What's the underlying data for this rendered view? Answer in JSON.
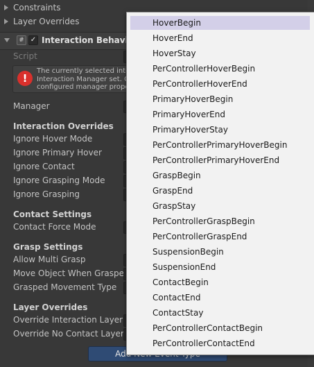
{
  "inspector": {
    "constraints_label": "Constraints",
    "layer_overrides_top_label": "Layer Overrides",
    "component_title": "Interaction Behaviour",
    "script_label": "Script",
    "help_text": "The currently selected inter\nInteraction Manager set. O\nconfigured manager proper",
    "manager_label": "Manager",
    "interaction_overrides_header": "Interaction Overrides",
    "ignore_hover_mode": "Ignore Hover Mode",
    "ignore_primary_hover": "Ignore Primary Hover",
    "ignore_contact": "Ignore Contact",
    "ignore_grasping_mode": "Ignore Grasping Mode",
    "ignore_grasping": "Ignore Grasping",
    "contact_settings_header": "Contact Settings",
    "contact_force_mode": "Contact Force Mode",
    "grasp_settings_header": "Grasp Settings",
    "allow_multi_grasp": "Allow Multi Grasp",
    "move_object_when_grasped": "Move Object When Grasped",
    "grasped_movement_type": "Grasped Movement Type",
    "layer_overrides_header": "Layer Overrides",
    "override_interaction_layer": "Override Interaction Layer",
    "override_no_contact_layer": "Override No Contact Layer",
    "add_event_button": "Add New Event Type"
  },
  "dropdown": {
    "selected": "HoverBegin",
    "items": [
      "HoverBegin",
      "HoverEnd",
      "HoverStay",
      "PerControllerHoverBegin",
      "PerControllerHoverEnd",
      "PrimaryHoverBegin",
      "PrimaryHoverEnd",
      "PrimaryHoverStay",
      "PerControllerPrimaryHoverBegin",
      "PerControllerPrimaryHoverEnd",
      "GraspBegin",
      "GraspEnd",
      "GraspStay",
      "PerControllerGraspBegin",
      "PerControllerGraspEnd",
      "SuspensionBegin",
      "SuspensionEnd",
      "ContactBegin",
      "ContactEnd",
      "ContactStay",
      "PerControllerContactBegin",
      "PerControllerContactEnd"
    ]
  },
  "colors": {
    "background": "#383838",
    "dropdown_bg": "#f2f2f2",
    "selected_item": "#d3cfe8",
    "error_icon": "#d9302c",
    "button": "#2f4b74"
  },
  "icons": [
    "foldout-arrow-icon",
    "script-component-icon",
    "checkbox-icon",
    "error-icon",
    "settings-gear-icon"
  ]
}
